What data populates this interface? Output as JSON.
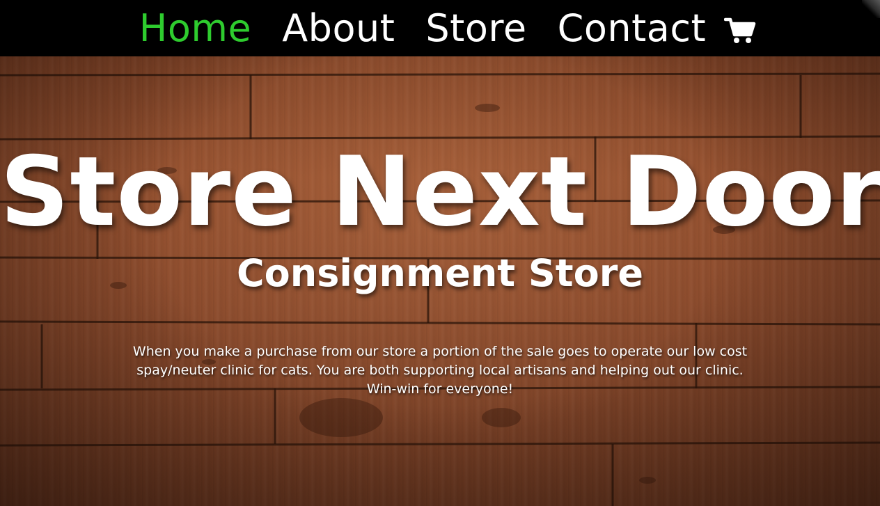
{
  "colors": {
    "nav_background": "#000000",
    "active_link": "#2ecc2e",
    "text": "#ffffff",
    "wood": "#8a4a2c"
  },
  "nav": {
    "items": [
      {
        "label": "Home",
        "active": true
      },
      {
        "label": "About",
        "active": false
      },
      {
        "label": "Store",
        "active": false
      },
      {
        "label": "Contact",
        "active": false
      }
    ],
    "cart_icon": "shopping-cart-icon"
  },
  "hero": {
    "title": "Store Next Door",
    "subtitle": "Consignment Store",
    "description": "When you make a purchase from our store a portion of the sale goes to operate our low cost spay/neuter clinic for cats.  You are both supporting local artisans and helping out our clinic. Win-win for everyone!"
  }
}
